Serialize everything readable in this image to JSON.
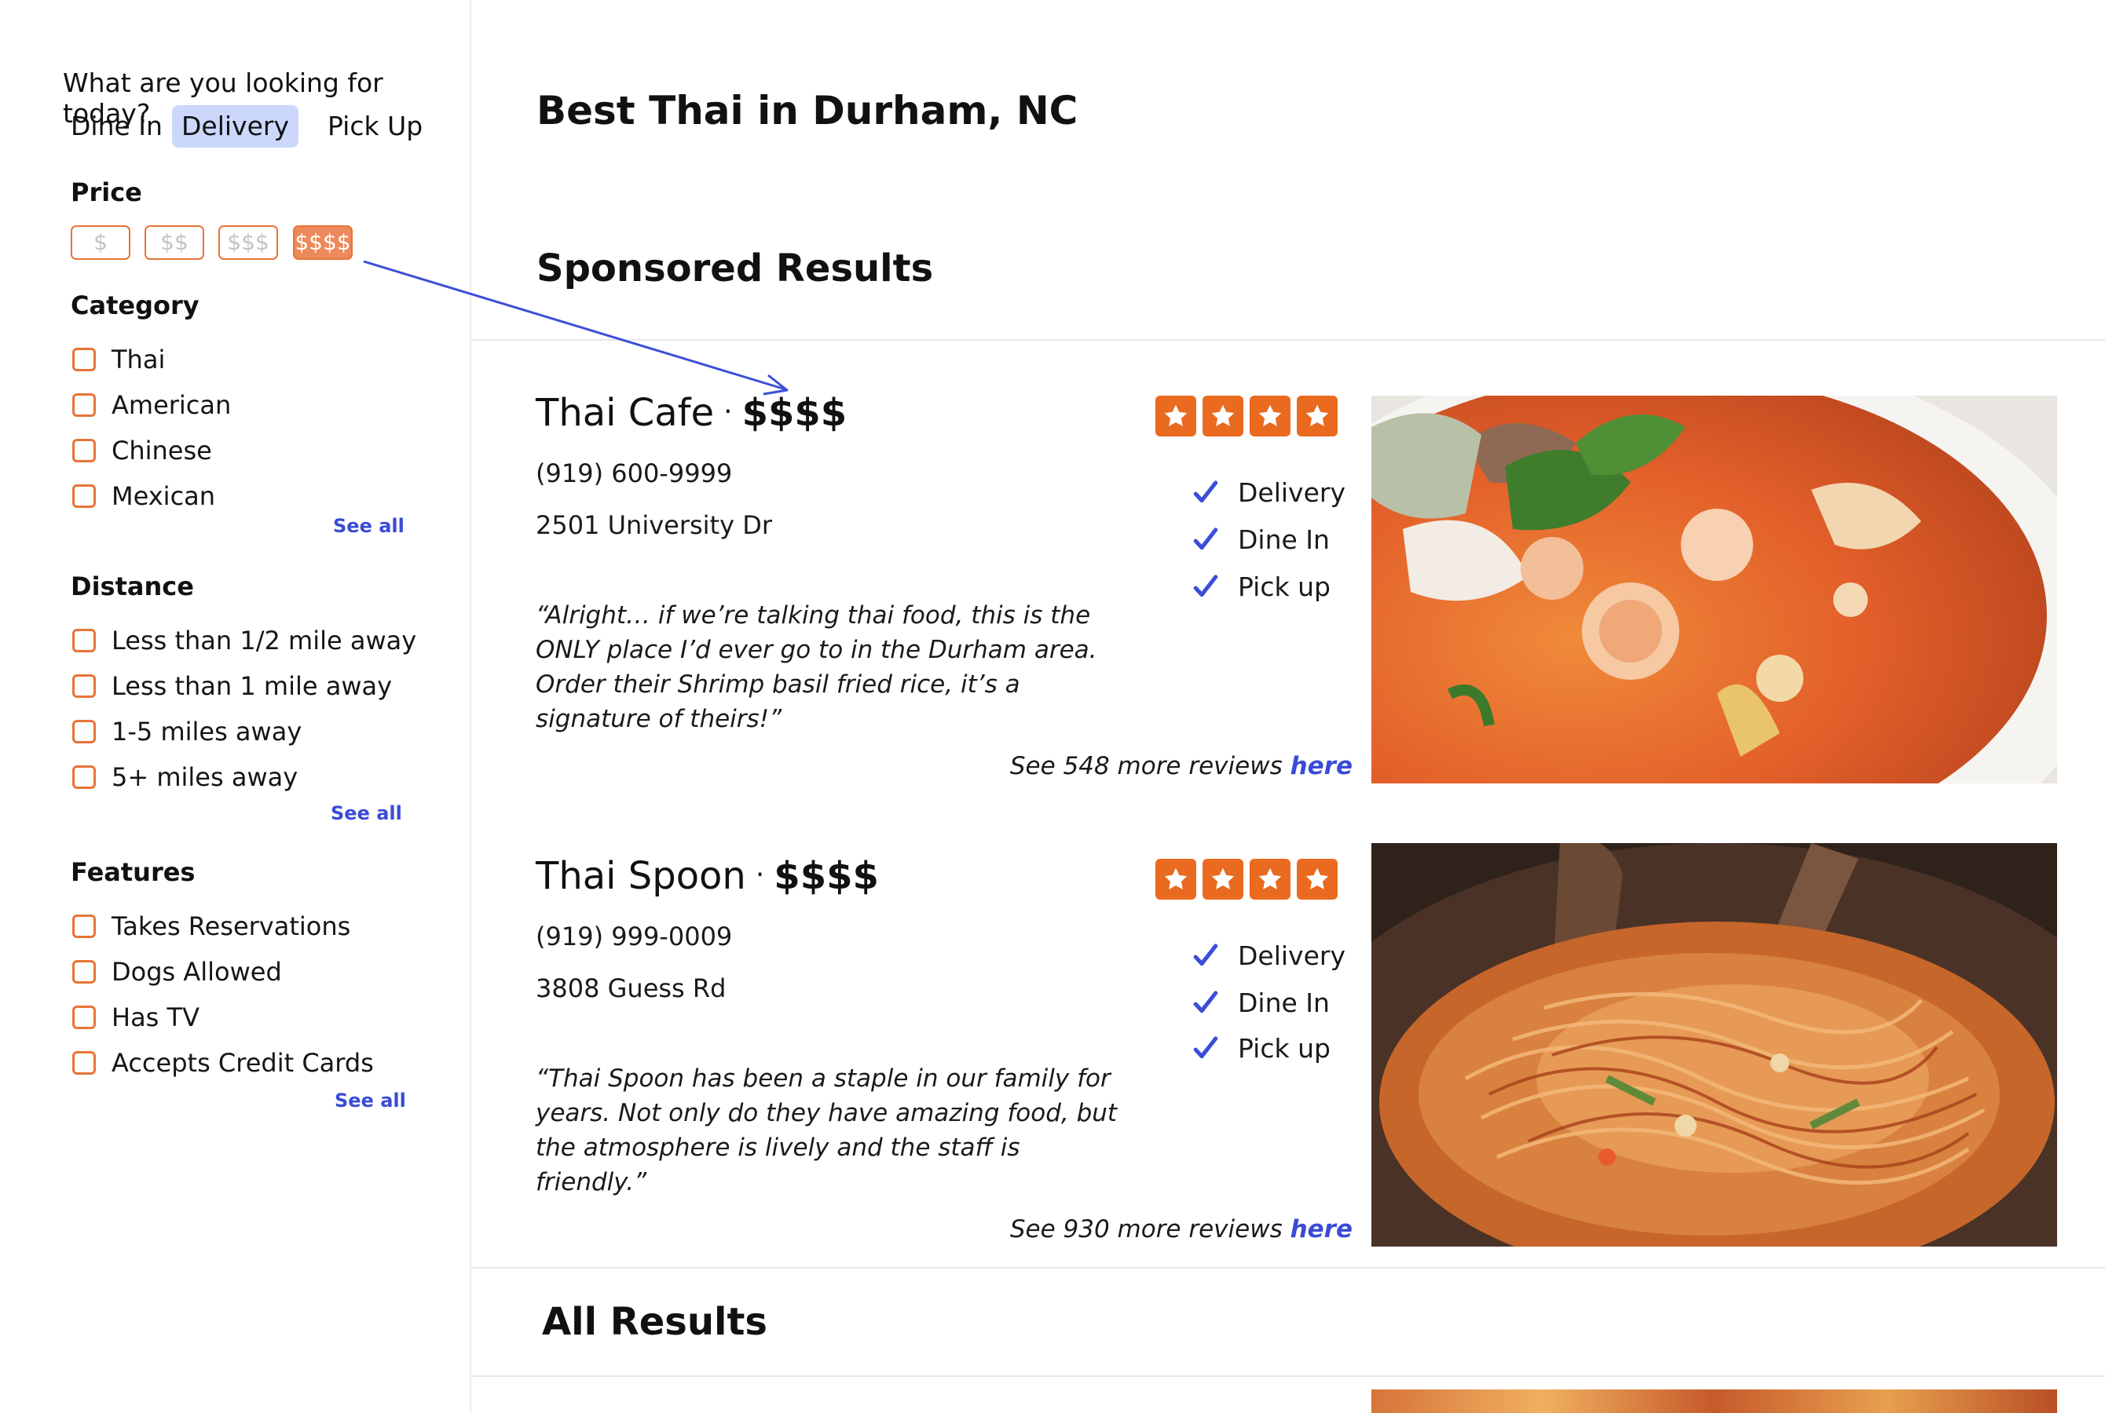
{
  "filters": {
    "question": "What are you looking for today?",
    "modes": [
      "Dine In",
      "Delivery",
      "Pick Up"
    ],
    "active_mode": "Delivery",
    "price": {
      "title": "Price",
      "options": [
        "$",
        "$$",
        "$$$",
        "$$$$"
      ],
      "selected": "$$$$"
    },
    "category": {
      "title": "Category",
      "items": [
        "Thai",
        "American",
        "Chinese",
        "Mexican"
      ],
      "see_all": "See all"
    },
    "distance": {
      "title": "Distance",
      "items": [
        "Less than 1/2 mile away",
        "Less than 1 mile away",
        "1-5 miles away",
        "5+ miles away"
      ],
      "see_all": "See all"
    },
    "features": {
      "title": "Features",
      "items": [
        "Takes Reservations",
        "Dogs Allowed",
        "Has TV",
        "Accepts Credit Cards"
      ],
      "see_all": "See all"
    }
  },
  "main": {
    "title": "Best Thai in Durham, NC",
    "sponsored_title": "Sponsored Results",
    "all_results_title": "All Results",
    "results": [
      {
        "name": "Thai Cafe",
        "separator": "·",
        "price": "$$$$",
        "phone": "(919) 600-9999",
        "address": "2501 University Dr",
        "rating": 4,
        "features": [
          "Delivery",
          "Dine In",
          "Pick up"
        ],
        "review": "“Alright… if we’re talking thai food, this is the ONLY place I’d ever go to in the Durham area. Order their Shrimp basil fried rice, it’s a signature of theirs!”",
        "more_reviews_prefix": "See 548 more reviews ",
        "more_reviews_link": "here"
      },
      {
        "name": "Thai Spoon",
        "separator": "·",
        "price": "$$$$",
        "phone": "(919) 999-0009",
        "address": "3808 Guess Rd",
        "rating": 4,
        "features": [
          "Delivery",
          "Dine In",
          "Pick up"
        ],
        "review": "“Thai Spoon has been a staple in our family for years. Not only do they have amazing food, but the atmosphere is lively and the staff is friendly.”",
        "more_reviews_prefix": "See 930 more reviews ",
        "more_reviews_link": "here"
      }
    ]
  },
  "colors": {
    "accent_orange": "#e87436",
    "star_orange": "#ea6a1f",
    "link_blue": "#3a4bd6",
    "active_mode_bg": "#cbd8fc"
  },
  "icons": [
    "star-icon",
    "check-icon",
    "annotation-arrow"
  ]
}
